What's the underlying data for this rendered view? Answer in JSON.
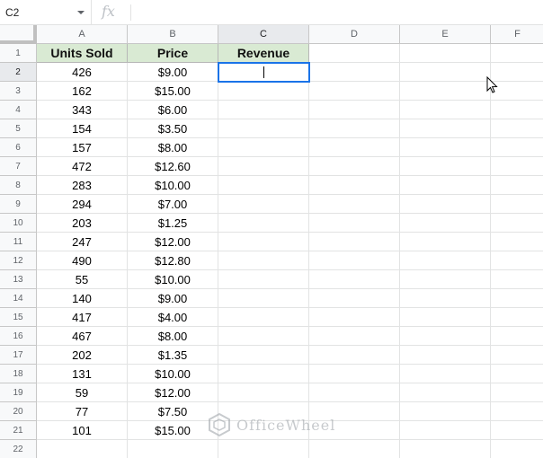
{
  "formula_bar": {
    "name_box": "C2",
    "fx_label": "fx",
    "formula": ""
  },
  "columns": [
    "A",
    "B",
    "C",
    "D",
    "E",
    "F"
  ],
  "selected_column": "C",
  "selected_row": 2,
  "rows": [
    {
      "num": "1",
      "a": "Units Sold",
      "b": "Price",
      "c": "Revenue"
    },
    {
      "num": "2",
      "a": "426",
      "b": "$9.00",
      "c": ""
    },
    {
      "num": "3",
      "a": "162",
      "b": "$15.00",
      "c": ""
    },
    {
      "num": "4",
      "a": "343",
      "b": "$6.00",
      "c": ""
    },
    {
      "num": "5",
      "a": "154",
      "b": "$3.50",
      "c": ""
    },
    {
      "num": "6",
      "a": "157",
      "b": "$8.00",
      "c": ""
    },
    {
      "num": "7",
      "a": "472",
      "b": "$12.60",
      "c": ""
    },
    {
      "num": "8",
      "a": "283",
      "b": "$10.00",
      "c": ""
    },
    {
      "num": "9",
      "a": "294",
      "b": "$7.00",
      "c": ""
    },
    {
      "num": "10",
      "a": "203",
      "b": "$1.25",
      "c": ""
    },
    {
      "num": "11",
      "a": "247",
      "b": "$12.00",
      "c": ""
    },
    {
      "num": "12",
      "a": "490",
      "b": "$12.80",
      "c": ""
    },
    {
      "num": "13",
      "a": "55",
      "b": "$10.00",
      "c": ""
    },
    {
      "num": "14",
      "a": "140",
      "b": "$9.00",
      "c": ""
    },
    {
      "num": "15",
      "a": "417",
      "b": "$4.00",
      "c": ""
    },
    {
      "num": "16",
      "a": "467",
      "b": "$8.00",
      "c": ""
    },
    {
      "num": "17",
      "a": "202",
      "b": "$1.35",
      "c": ""
    },
    {
      "num": "18",
      "a": "131",
      "b": "$10.00",
      "c": ""
    },
    {
      "num": "19",
      "a": "59",
      "b": "$12.00",
      "c": ""
    },
    {
      "num": "20",
      "a": "77",
      "b": "$7.50",
      "c": ""
    },
    {
      "num": "21",
      "a": "101",
      "b": "$15.00",
      "c": ""
    },
    {
      "num": "22",
      "a": "",
      "b": "",
      "c": ""
    }
  ],
  "watermark": "OfficeWheel",
  "colors": {
    "header_fill": "#d9ead3",
    "selection": "#1a73e8"
  }
}
